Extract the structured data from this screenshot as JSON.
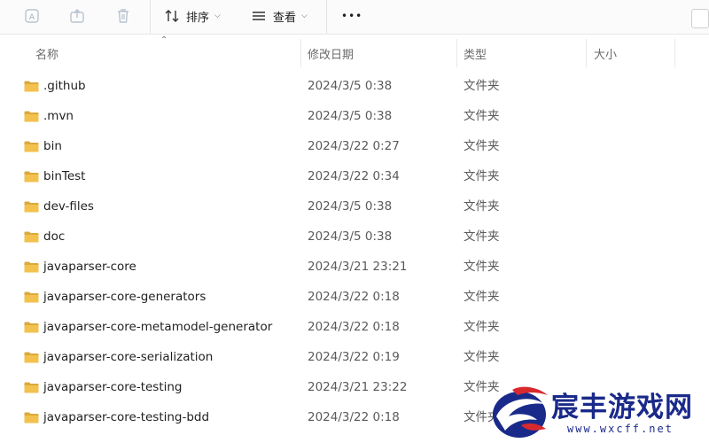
{
  "toolbar": {
    "sort_label": "排序",
    "view_label": "查看",
    "more_label": "•••"
  },
  "columns": {
    "name": "名称",
    "date": "修改日期",
    "type": "类型",
    "size": "大小"
  },
  "rows": [
    {
      "name": ".github",
      "date": "2024/3/5 0:38",
      "type": "文件夹"
    },
    {
      "name": ".mvn",
      "date": "2024/3/5 0:38",
      "type": "文件夹"
    },
    {
      "name": "bin",
      "date": "2024/3/22 0:27",
      "type": "文件夹"
    },
    {
      "name": "binTest",
      "date": "2024/3/22 0:34",
      "type": "文件夹"
    },
    {
      "name": "dev-files",
      "date": "2024/3/5 0:38",
      "type": "文件夹"
    },
    {
      "name": "doc",
      "date": "2024/3/5 0:38",
      "type": "文件夹"
    },
    {
      "name": "javaparser-core",
      "date": "2024/3/21 23:21",
      "type": "文件夹"
    },
    {
      "name": "javaparser-core-generators",
      "date": "2024/3/22 0:18",
      "type": "文件夹"
    },
    {
      "name": "javaparser-core-metamodel-generator",
      "date": "2024/3/22 0:18",
      "type": "文件夹"
    },
    {
      "name": "javaparser-core-serialization",
      "date": "2024/3/22 0:19",
      "type": "文件夹"
    },
    {
      "name": "javaparser-core-testing",
      "date": "2024/3/21 23:22",
      "type": "文件夹"
    },
    {
      "name": "javaparser-core-testing-bdd",
      "date": "2024/3/22 0:18",
      "type": "文件夹"
    }
  ],
  "watermark": {
    "brand": "宸丰游戏网",
    "url": "www.wxcff.net"
  },
  "colors": {
    "folder": "#f2c14e",
    "folder_dark": "#dca93a",
    "watermark": "#1a2a8a",
    "watermark_red": "#d8292f"
  }
}
